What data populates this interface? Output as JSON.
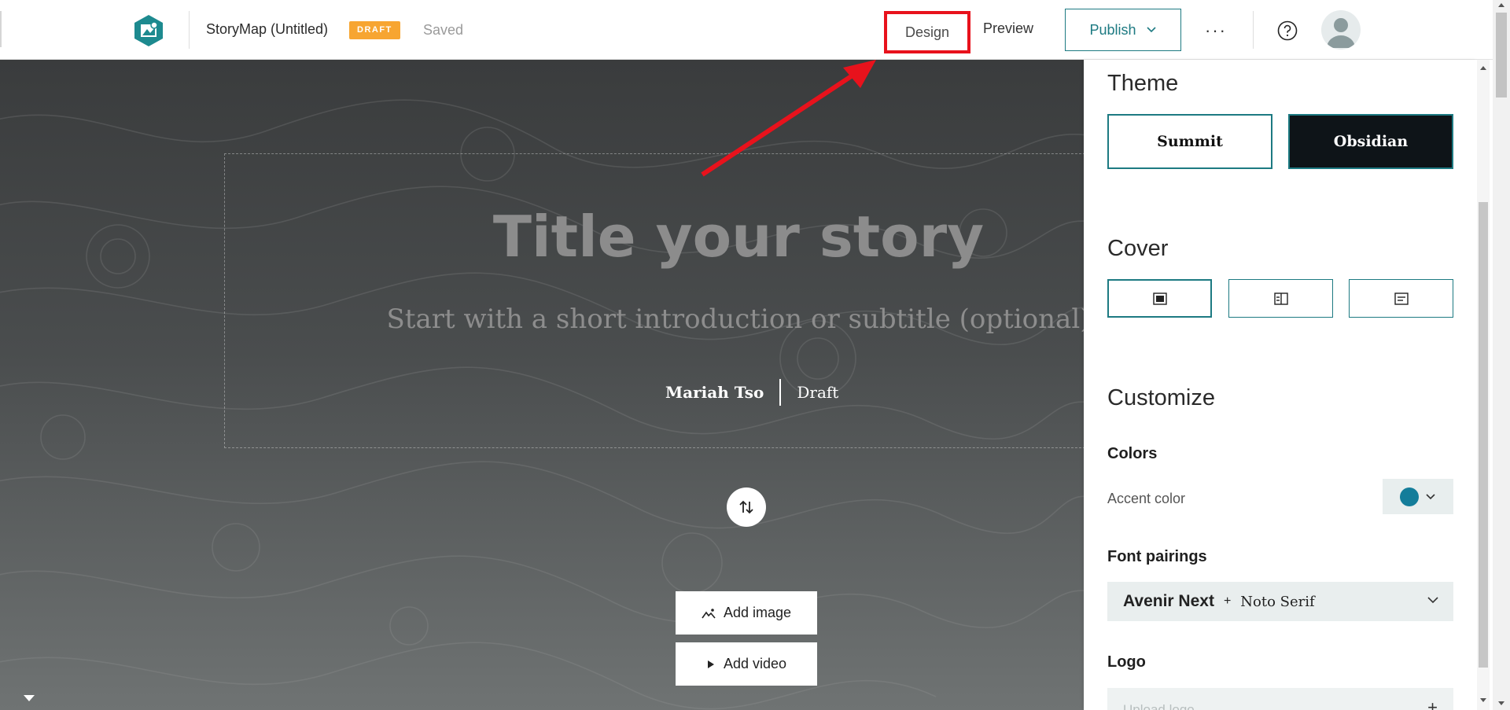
{
  "header": {
    "story_title": "StoryMap (Untitled)",
    "draft_badge": "DRAFT",
    "save_status": "Saved",
    "design_label": "Design",
    "preview_label": "Preview",
    "publish_label": "Publish",
    "more_label": "···"
  },
  "canvas": {
    "heading": "Title your story",
    "subtitle": "Start with a short introduction or subtitle (optional)",
    "author": "Mariah Tso",
    "status": "Draft",
    "add_image_label": "Add image",
    "add_video_label": "Add video"
  },
  "panel": {
    "theme_title": "Theme",
    "themes": [
      "Summit",
      "Obsidian"
    ],
    "selected_theme": "Obsidian",
    "cover_title": "Cover",
    "cover_options_selected_index": 0,
    "customize_title": "Customize",
    "colors_label": "Colors",
    "accent_label": "Accent color",
    "accent_color": "#147d9a",
    "font_pairings_label": "Font pairings",
    "font_primary": "Avenir Next",
    "font_plus": "+",
    "font_secondary": "Noto Serif",
    "logo_label": "Logo",
    "logo_upload_placeholder": "Upload logo"
  },
  "colors": {
    "brand": "#1d7a82",
    "draft_badge": "#f7a531",
    "annotation_red": "#e8121c"
  }
}
